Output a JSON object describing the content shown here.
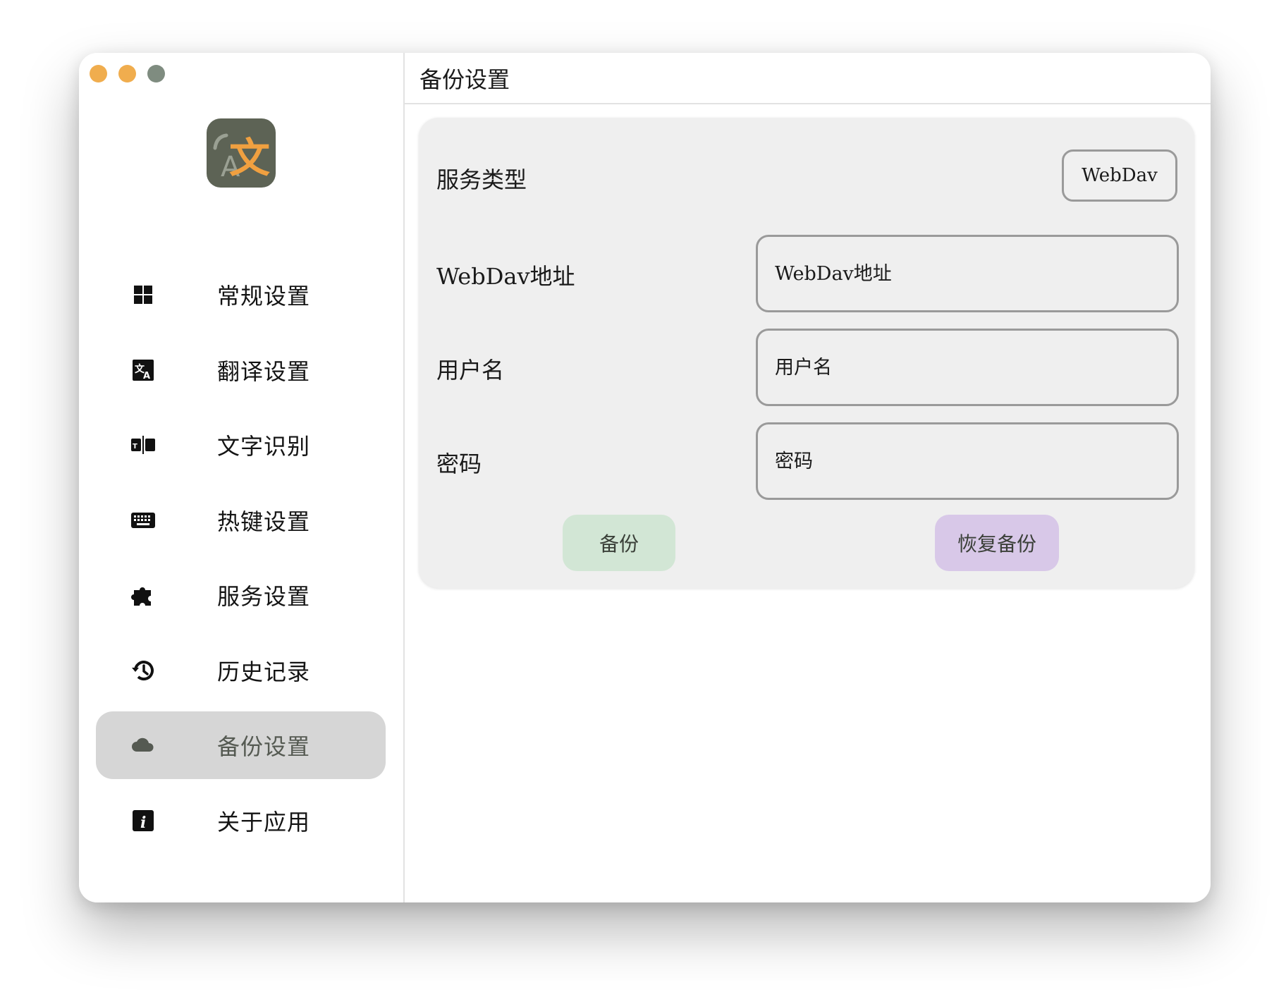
{
  "window": {
    "traffic_lights": [
      "#f0ad4e",
      "#f0ad4e",
      "#7f8c80"
    ]
  },
  "app_logo": {
    "icon": "translate-logo-icon",
    "background": "#5d6355",
    "accent": "#f0a040"
  },
  "sidebar": {
    "items": [
      {
        "label": "常规设置",
        "icon": "grid-icon"
      },
      {
        "label": "翻译设置",
        "icon": "translate-icon"
      },
      {
        "label": "文字识别",
        "icon": "ocr-icon"
      },
      {
        "label": "热键设置",
        "icon": "keyboard-icon"
      },
      {
        "label": "服务设置",
        "icon": "puzzle-icon"
      },
      {
        "label": "历史记录",
        "icon": "history-icon"
      },
      {
        "label": "备份设置",
        "icon": "cloud-icon",
        "active": true
      },
      {
        "label": "关于应用",
        "icon": "info-icon"
      }
    ]
  },
  "header": {
    "title": "备份设置"
  },
  "form": {
    "service_type": {
      "label": "服务类型",
      "value": "WebDav"
    },
    "url": {
      "label": "WebDav地址",
      "placeholder": "WebDav地址"
    },
    "username": {
      "label": "用户名",
      "placeholder": "用户名"
    },
    "password": {
      "label": "密码",
      "placeholder": "密码"
    },
    "backup_button": "备份",
    "restore_button": "恢复备份"
  },
  "colors": {
    "active_item_bg": "#d6d6d6",
    "backup_button_bg": "#d2e6d5",
    "restore_button_bg": "#d8c8e8"
  }
}
